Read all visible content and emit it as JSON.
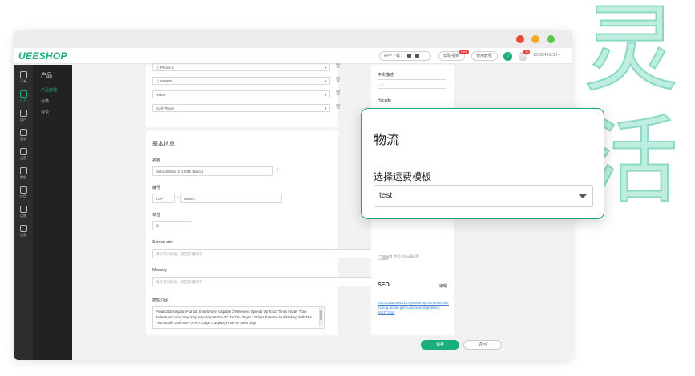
{
  "decor": {
    "chars": [
      "灵",
      "活"
    ]
  },
  "app": {
    "logo": "UEESHOP"
  },
  "topbar": {
    "app_download": "APP下载：",
    "help": "帮助视频",
    "tutorial": "使用教程",
    "new_badge": "New",
    "msg_count": "30",
    "account": "13580496214"
  },
  "sidebar": {
    "items": [
      {
        "label": "订单",
        "icon": "clipboard-icon"
      },
      {
        "label": "产品",
        "icon": "cube-icon"
      },
      {
        "label": "用户",
        "icon": "users-icon"
      },
      {
        "label": "营销",
        "icon": "ticket-icon"
      },
      {
        "label": "运营",
        "icon": "share-icon"
      },
      {
        "label": "数据",
        "icon": "chart-icon"
      },
      {
        "label": "应用",
        "icon": "apps-icon"
      },
      {
        "label": "店铺",
        "icon": "store-icon"
      },
      {
        "label": "设置",
        "icon": "gear-icon"
      }
    ],
    "active_index": 1
  },
  "subnav": {
    "title": "产品",
    "items": [
      "产品管理",
      "分类",
      "评论"
    ]
  },
  "variants": {
    "rows": [
      "| | iPhone 6",
      "| | IMB655",
      "iVideo",
      "iCell Phone"
    ]
  },
  "basic_info": {
    "heading": "基本信息",
    "name_label": "名称",
    "name_value": "Motorol Moto G 16GB (Black)",
    "name_required": "*",
    "sku_label": "编号",
    "sku_prefix": "TOP",
    "sku_sep": "-",
    "sku_value": "996577",
    "unit_label": "单位",
    "unit_value": "Ιß",
    "screen_label": "Screen size",
    "screen_placeholder": "填写可内级别，按回车键保存",
    "memory_label": "Memory",
    "memory_placeholder": "填写可内级别，按回车键保存",
    "desc_label": "简短介绍",
    "desc_value": "Product DescriptionAndroid Smartphone Capable Of Wireless Speeds Up To 10 Times Faster Than Today&amp;amp;amp;amp;amp;amp;#039;s 3G NVIDIA Tegra 2 Brings Extreme Multitasking With The First Mobile Dual-core CPU A Large 4.3 qHD (Finch-to-zoom Disp"
  },
  "right_panel": {
    "cn_desc_label": "中文描述",
    "cn_desc_value": "1",
    "hscode_label": "Hscode",
    "toggle_label": "使用全部计算运费",
    "seo_title": "SEO",
    "seo_edit": "编辑",
    "seo_link": "http://13580496214.myueeshop.com/motorola-moto-g-global-gsm-unlocked-16gb-black-p0137.html"
  },
  "footer": {
    "save": "保存",
    "back": "返回"
  },
  "popup": {
    "title": "物流",
    "label": "选择运费模板",
    "selected": "test"
  }
}
